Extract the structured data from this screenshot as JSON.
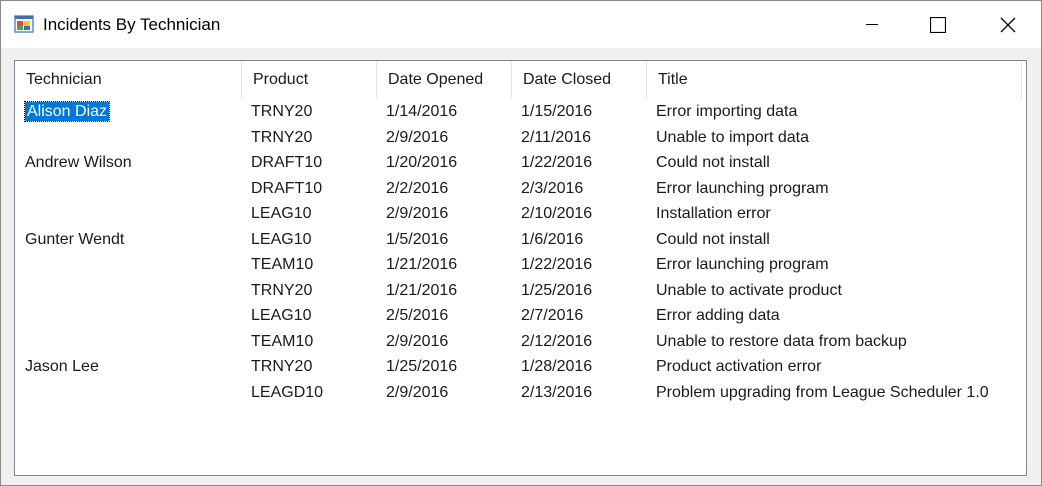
{
  "window": {
    "title": "Incidents By Technician",
    "icon": "winforms-app-icon",
    "controls": {
      "minimize": "minimize-icon",
      "maximize": "maximize-icon",
      "close": "close-icon"
    }
  },
  "listview": {
    "columns": [
      "Technician",
      "Product",
      "Date Opened",
      "Date Closed",
      "Title"
    ],
    "rows": [
      {
        "technician": "Alison Diaz",
        "product": "TRNY20",
        "opened": "1/14/2016",
        "closed": "1/15/2016",
        "title": "Error importing data",
        "selected": true
      },
      {
        "technician": "",
        "product": "TRNY20",
        "opened": "2/9/2016",
        "closed": "2/11/2016",
        "title": "Unable to import data"
      },
      {
        "technician": "Andrew Wilson",
        "product": "DRAFT10",
        "opened": "1/20/2016",
        "closed": "1/22/2016",
        "title": "Could not install"
      },
      {
        "technician": "",
        "product": "DRAFT10",
        "opened": "2/2/2016",
        "closed": "2/3/2016",
        "title": "Error launching program"
      },
      {
        "technician": "",
        "product": "LEAG10",
        "opened": "2/9/2016",
        "closed": "2/10/2016",
        "title": "Installation error"
      },
      {
        "technician": "Gunter Wendt",
        "product": "LEAG10",
        "opened": "1/5/2016",
        "closed": "1/6/2016",
        "title": "Could not install"
      },
      {
        "technician": "",
        "product": "TEAM10",
        "opened": "1/21/2016",
        "closed": "1/22/2016",
        "title": "Error launching program"
      },
      {
        "technician": "",
        "product": "TRNY20",
        "opened": "1/21/2016",
        "closed": "1/25/2016",
        "title": "Unable to activate product"
      },
      {
        "technician": "",
        "product": "LEAG10",
        "opened": "2/5/2016",
        "closed": "2/7/2016",
        "title": "Error adding data"
      },
      {
        "technician": "",
        "product": "TEAM10",
        "opened": "2/9/2016",
        "closed": "2/12/2016",
        "title": "Unable to restore data from backup"
      },
      {
        "technician": "Jason Lee",
        "product": "TRNY20",
        "opened": "1/25/2016",
        "closed": "1/28/2016",
        "title": "Product activation error"
      },
      {
        "technician": "",
        "product": "LEAGD10",
        "opened": "2/9/2016",
        "closed": "2/13/2016",
        "title": "Problem upgrading from League Scheduler 1.0"
      }
    ]
  }
}
